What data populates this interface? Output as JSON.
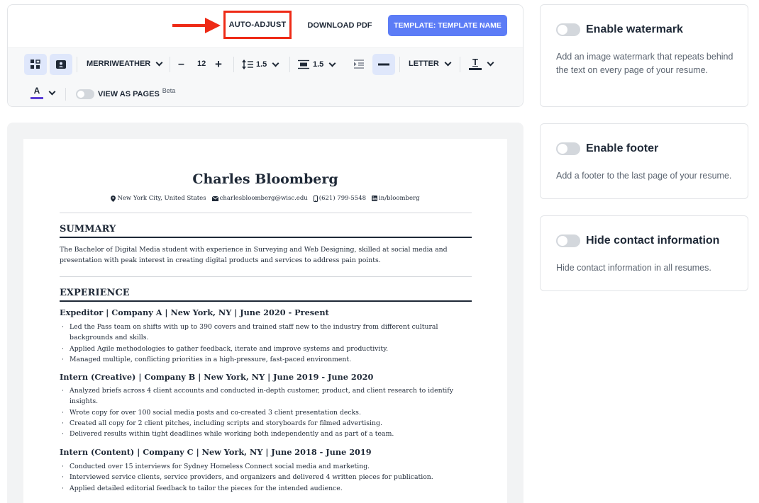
{
  "toolbar": {
    "auto_adjust_label": "AUTO-ADJUST",
    "download_label": "DOWNLOAD PDF",
    "template_label": "TEMPLATE: TEMPLATE NAME",
    "font_family": "MERRIWEATHER",
    "font_size": "12",
    "line_spacing": "1.5",
    "paragraph_spacing": "1.5",
    "page_size": "LETTER",
    "view_as_pages_label": "VIEW AS PAGES",
    "beta_label": "Beta",
    "accent_color": "#5c7cf6",
    "highlight_color": "#ee2a16",
    "text_color_underline": "#1f2937",
    "font_color_underline": "#5b3fd6"
  },
  "resume": {
    "name": "Charles Bloomberg",
    "contact": {
      "location": "New York City, United States",
      "email": "charlesbloomberg@wisc.edu",
      "phone": "(621) 799-5548",
      "linkedin": "in/bloomberg"
    },
    "summary_heading": "SUMMARY",
    "summary_text": "The Bachelor of Digital Media student with experience in Surveying and Web Designing, skilled at social media and presentation with peak interest in creating digital products and services to address pain points.",
    "experience_heading": "EXPERIENCE",
    "jobs": [
      {
        "title": "Expeditor | Company A | New York, NY | June 2020 - Present",
        "bullets": [
          "Led the Pass team on shifts with up to 390 covers and trained staff new to the industry from different cultural backgrounds and skills.",
          "Applied Agile methodologies to gather feedback, iterate and improve systems and productivity.",
          "Managed multiple, conflicting priorities in a high-pressure, fast-paced environment."
        ]
      },
      {
        "title": "Intern (Creative) | Company B | New York, NY | June 2019 - June 2020",
        "bullets": [
          "Analyzed briefs across 4 client accounts and conducted in-depth customer, product, and client research to identify insights.",
          "Wrote copy for over 100 social media posts and co-created 3 client presentation decks.",
          "Created all copy for 2 client pitches, including scripts and storyboards for filmed advertising.",
          "Delivered results within tight deadlines while working both independently and as part of a team."
        ]
      },
      {
        "title": "Intern (Content) | Company C | New York, NY | June 2018 - June 2019",
        "bullets": [
          "Conducted over 15 interviews for Sydney Homeless Connect social media and marketing.",
          "Interviewed service clients, service providers, and organizers and delivered 4 written pieces for publication.",
          "Applied detailed editorial feedback to tailor the pieces for the intended audience."
        ]
      }
    ]
  },
  "settings": {
    "watermark": {
      "title": "Enable watermark",
      "desc": "Add an image watermark that repeats behind the text on every page of your resume."
    },
    "footer": {
      "title": "Enable footer",
      "desc": "Add a footer to the last page of your resume."
    },
    "hide_contact": {
      "title": "Hide contact information",
      "desc": "Hide contact information in all resumes."
    }
  }
}
